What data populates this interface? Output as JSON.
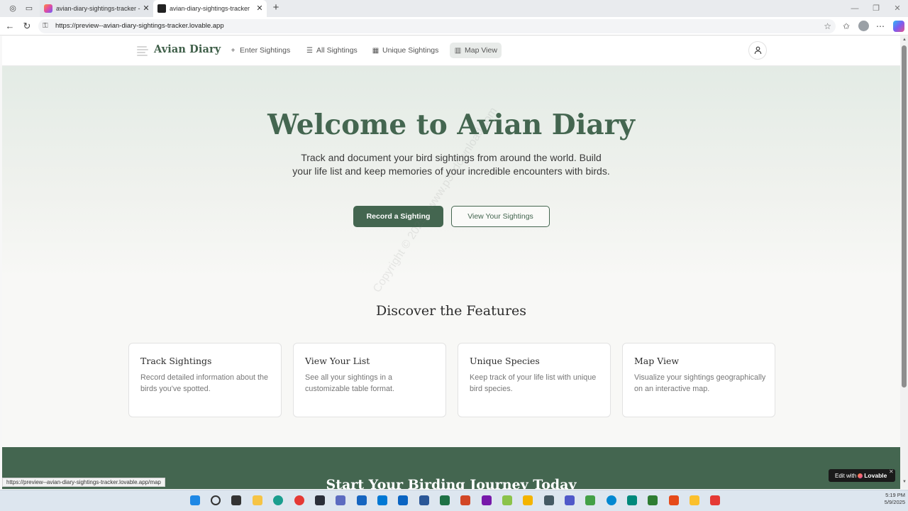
{
  "browser": {
    "tabs": [
      {
        "title": "avian-diary-sightings-tracker - Lo",
        "active": false
      },
      {
        "title": "avian-diary-sightings-tracker",
        "active": true
      }
    ],
    "address": "https://preview--avian-diary-sightings-tracker.lovable.app",
    "status_url": "https://preview--avian-diary-sightings-tracker.lovable.app/map"
  },
  "site": {
    "brand": "Avian Diary",
    "nav": [
      {
        "label": "Enter Sightings",
        "icon": "plus-icon"
      },
      {
        "label": "All Sightings",
        "icon": "list-icon"
      },
      {
        "label": "Unique Sightings",
        "icon": "calendar-icon"
      },
      {
        "label": "Map View",
        "icon": "map-icon",
        "active": true
      }
    ]
  },
  "hero": {
    "title": "Welcome to Avian Diary",
    "subtitle": "Track and document your bird sightings from around the world. Build your life list and keep memories of your incredible encounters with birds.",
    "primary_button": "Record a Sighting",
    "secondary_button": "View Your Sightings"
  },
  "features": {
    "title": "Discover the Features",
    "cards": [
      {
        "title": "Track Sightings",
        "description": "Record detailed information about the birds you've spotted."
      },
      {
        "title": "View Your List",
        "description": "See all your sightings in a customizable table format."
      },
      {
        "title": "Unique Species",
        "description": "Keep track of your life list with unique bird species."
      },
      {
        "title": "Map View",
        "description": "Visualize your sightings geographically on an interactive map."
      }
    ]
  },
  "cta": {
    "title": "Start Your Birding Journey Today"
  },
  "watermark": "Copyright © 2025 - www.p30download.com",
  "badge": {
    "prefix": "Edit with",
    "brand": "Lovable"
  },
  "clock": {
    "time": "5:19 PM",
    "date": "5/9/2025"
  },
  "colors": {
    "accent": "#446650",
    "hero_bg": "#e3ebe5",
    "cta_bg": "#446650"
  }
}
